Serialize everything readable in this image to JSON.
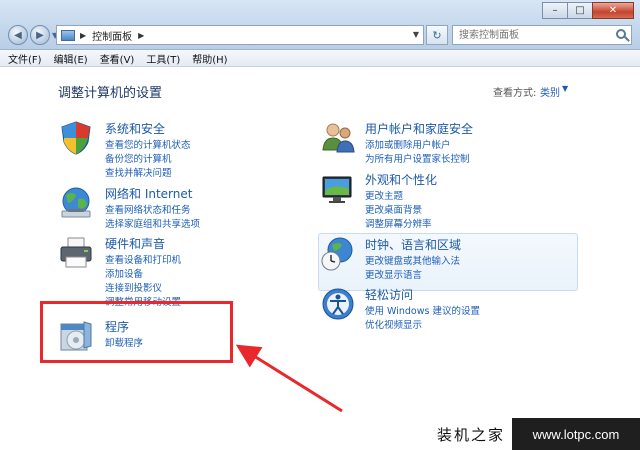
{
  "address": {
    "path": "控制面板",
    "search_placeholder": "搜索控制面板"
  },
  "menu": [
    "文件(F)",
    "编辑(E)",
    "查看(V)",
    "工具(T)",
    "帮助(H)"
  ],
  "page": {
    "title": "调整计算机的设置",
    "view_by_label": "查看方式:",
    "view_by_value": "类别"
  },
  "categories": {
    "system": {
      "title": "系统和安全",
      "links": [
        "查看您的计算机状态",
        "备份您的计算机",
        "查找并解决问题"
      ]
    },
    "network": {
      "title": "网络和 Internet",
      "links": [
        "查看网络状态和任务",
        "选择家庭组和共享选项"
      ]
    },
    "hardware": {
      "title": "硬件和声音",
      "links": [
        "查看设备和打印机",
        "添加设备",
        "连接到投影仪",
        "调整常用移动设置"
      ]
    },
    "programs": {
      "title": "程序",
      "links": [
        "卸载程序"
      ]
    },
    "users": {
      "title": "用户帐户和家庭安全",
      "links": [
        "添加或删除用户帐户",
        "为所有用户设置家长控制"
      ]
    },
    "appearance": {
      "title": "外观和个性化",
      "links": [
        "更改主题",
        "更改桌面背景",
        "调整屏幕分辨率"
      ]
    },
    "clock": {
      "title": "时钟、语言和区域",
      "links": [
        "更改键盘或其他输入法",
        "更改显示语言"
      ]
    },
    "ease": {
      "title": "轻松访问",
      "links": [
        "使用 Windows 建议的设置",
        "优化视频显示"
      ]
    }
  },
  "watermark": {
    "left": "装机之家",
    "right": "www.lotpc.com"
  },
  "colors": {
    "annotation_red": "#e8282a",
    "link_blue": "#1d5fb8"
  }
}
